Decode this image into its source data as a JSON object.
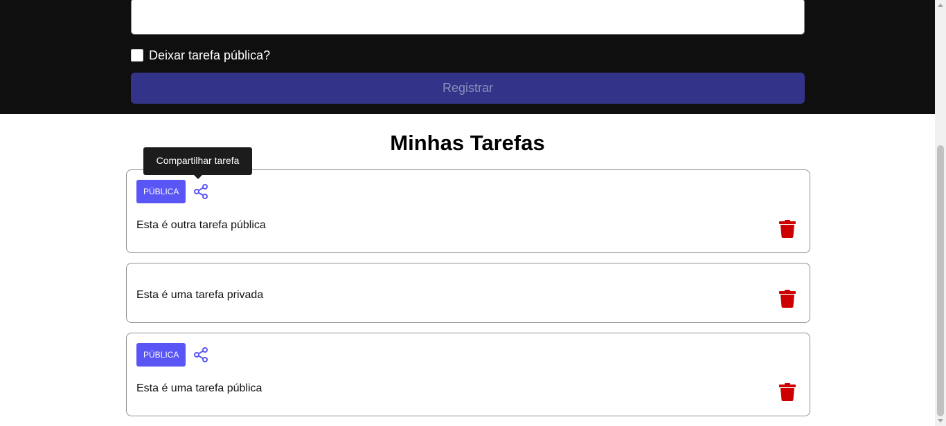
{
  "form": {
    "textarea_value": "",
    "public_checkbox_label": "Deixar tarefa pública?",
    "public_checkbox_checked": false,
    "submit_label": "Registrar"
  },
  "main": {
    "title": "Minhas Tarefas"
  },
  "tooltip": {
    "text": "Compartilhar tarefa"
  },
  "tasks": [
    {
      "badge": "PÚBLICA",
      "text": "Esta é outra tarefa pública",
      "public": true,
      "share_icon": "share-icon",
      "delete_icon": "trash-icon"
    },
    {
      "badge": "",
      "text": "Esta é uma tarefa privada",
      "public": false,
      "delete_icon": "trash-icon"
    },
    {
      "badge": "PÚBLICA",
      "text": "Esta é uma tarefa pública",
      "public": true,
      "share_icon": "share-icon",
      "delete_icon": "trash-icon"
    }
  ],
  "colors": {
    "header_bg": "#0f0f0f",
    "submit_bg": "#33338a",
    "badge_bg": "#5a55f5",
    "share_icon": "#5a55f5",
    "trash_icon": "#cc0000"
  }
}
